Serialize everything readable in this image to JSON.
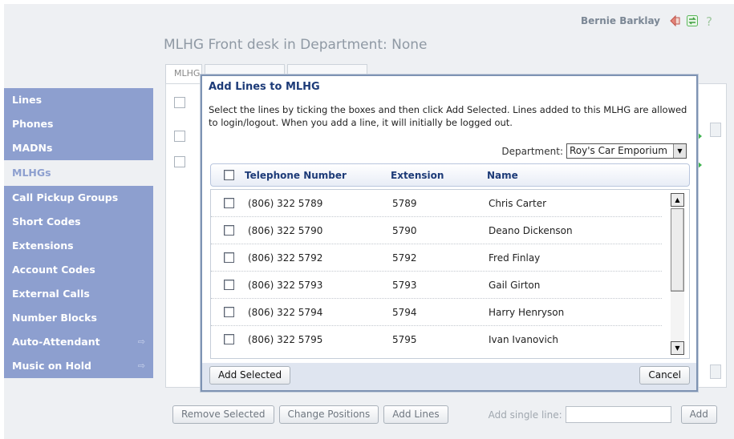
{
  "header": {
    "user_name": "Bernie Barklay",
    "page_title": "MLHG Front desk in Department: None",
    "icons": [
      "logout-icon",
      "refresh-icon",
      "help-icon"
    ]
  },
  "background_tabs": [
    "MLHG",
    "",
    ""
  ],
  "sidebar": {
    "items": [
      {
        "label": "Lines",
        "active": false,
        "external": false
      },
      {
        "label": "Phones",
        "active": false,
        "external": false
      },
      {
        "label": "MADNs",
        "active": false,
        "external": false
      },
      {
        "label": "MLHGs",
        "active": true,
        "external": false
      },
      {
        "label": "Call Pickup Groups",
        "active": false,
        "external": false
      },
      {
        "label": "Short Codes",
        "active": false,
        "external": false
      },
      {
        "label": "Extensions",
        "active": false,
        "external": false
      },
      {
        "label": "Account Codes",
        "active": false,
        "external": false
      },
      {
        "label": "External Calls",
        "active": false,
        "external": false
      },
      {
        "label": "Number Blocks",
        "active": false,
        "external": false
      },
      {
        "label": "Auto-Attendant",
        "active": false,
        "external": true
      },
      {
        "label": "Music on Hold",
        "active": false,
        "external": true
      }
    ],
    "external_icon": "⇨"
  },
  "bottom_bar": {
    "remove_selected": "Remove Selected",
    "change_positions": "Change Positions",
    "add_lines": "Add Lines",
    "add_single_line_label": "Add single line:",
    "add_single_line_value": "",
    "add": "Add"
  },
  "dialog": {
    "title": "Add Lines to MLHG",
    "description": "Select the lines by ticking the boxes and then click Add Selected.  Lines added to this MLHG are allowed to login/logout. When you add a line, it will initially be logged out.",
    "department_label": "Department:",
    "department_value": "Roy's Car Emporium",
    "columns": {
      "telephone": "Telephone Number",
      "extension": "Extension",
      "name": "Name"
    },
    "rows": [
      {
        "telephone": "(806) 322 5789",
        "extension": "5789",
        "name": "Chris Carter",
        "checked": false
      },
      {
        "telephone": "(806) 322 5790",
        "extension": "5790",
        "name": "Deano Dickenson",
        "checked": false
      },
      {
        "telephone": "(806) 322 5792",
        "extension": "5792",
        "name": "Fred Finlay",
        "checked": false
      },
      {
        "telephone": "(806) 322 5793",
        "extension": "5793",
        "name": "Gail Girton",
        "checked": false
      },
      {
        "telephone": "(806) 322 5794",
        "extension": "5794",
        "name": "Harry Henryson",
        "checked": false
      },
      {
        "telephone": "(806) 322 5795",
        "extension": "5795",
        "name": "Ivan Ivanovich",
        "checked": false
      }
    ],
    "add_selected": "Add Selected",
    "cancel": "Cancel"
  },
  "colors": {
    "sidebar_bg": "#8d9fcf",
    "accent_text": "#1d3b78",
    "dialog_border": "#7e93b3"
  }
}
